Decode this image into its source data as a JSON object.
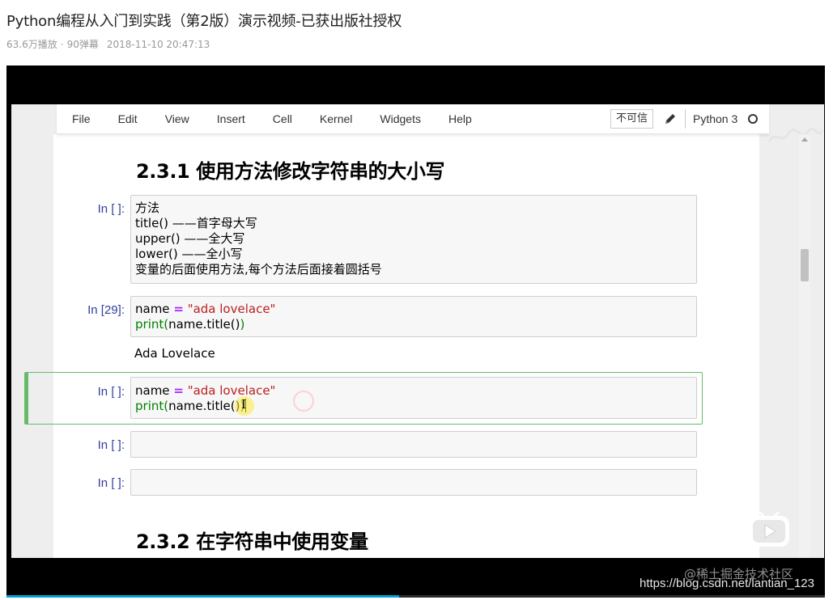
{
  "page": {
    "title": "Python编程从入门到实践（第2版）演示视频-已获出版社授权",
    "views": "63.6万播放",
    "separator": "·",
    "danmaku": "90弹幕",
    "date": "2018-11-10 20:47:13"
  },
  "progress": {
    "fraction": 0.48,
    "color": "#00a1d6"
  },
  "jupyter": {
    "menu": [
      "File",
      "Edit",
      "View",
      "Insert",
      "Cell",
      "Kernel",
      "Widgets",
      "Help"
    ],
    "trust_label": "不可信",
    "kernel_name": "Python 3",
    "heading1": "2.3.1 使用方法修改字符串的大小写",
    "heading2": "2.3.2 在字符串中使用变量",
    "cells": {
      "c1": {
        "prompt": "In [ ]:",
        "lines": [
          "方法",
          "title() ——首字母大写",
          "upper() ——全大写",
          "lower() ——全小写",
          "变量的后面使用方法,每个方法后面接着圆括号"
        ]
      },
      "c2": {
        "prompt": "In [29]:",
        "var": "name",
        "op": "=",
        "str": "\"ada lovelace\"",
        "print_fn": "print",
        "open_paren": "(",
        "call": "name.title()",
        "close_paren": ")",
        "output": "Ada Lovelace"
      },
      "c3": {
        "prompt": "In [ ]:",
        "var": "name",
        "op": "=",
        "str": "\"ada lovelace\"",
        "print_fn": "print",
        "open_paren": "(",
        "call": "name.title()",
        "close_paren": ")"
      },
      "c4": {
        "prompt": "In [ ]:"
      },
      "c5": {
        "prompt": "In [ ]:"
      }
    }
  },
  "watermarks": {
    "site": "@稀土掘金技术社区",
    "url": "https://blog.csdn.net/lantian_123"
  },
  "icons": [
    "pencil-icon",
    "kernel-idle-icon",
    "play-icon",
    "text-cursor-icon"
  ]
}
